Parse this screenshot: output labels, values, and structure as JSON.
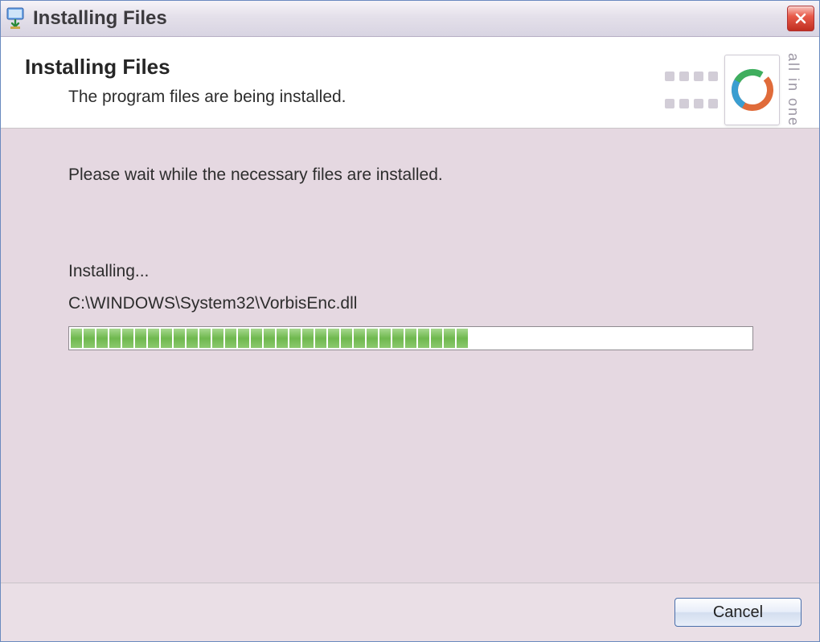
{
  "titlebar": {
    "title": "Installing Files"
  },
  "header": {
    "title": "Installing Files",
    "subtitle": "The program files are being installed."
  },
  "logo": {
    "tagline": "all in one"
  },
  "body": {
    "wait_text": "Please wait while the necessary files are installed.",
    "installing_label": "Installing...",
    "file_path": "C:\\WINDOWS\\System32\\VorbisEnc.dll",
    "progress_segments": 31,
    "progress_total_segments": 56
  },
  "footer": {
    "cancel_label": "Cancel"
  }
}
